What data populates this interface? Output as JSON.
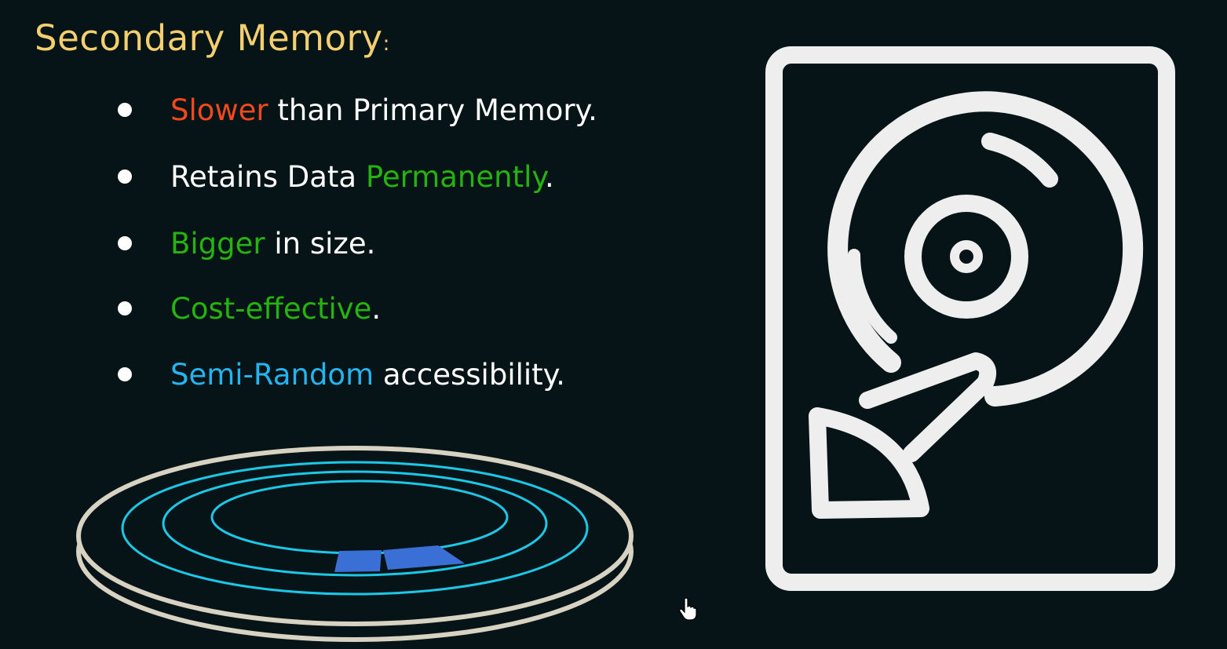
{
  "slide": {
    "title": "Secondary Memory",
    "title_colon": ":",
    "bullets": [
      {
        "pre": "",
        "highlight": "Slower",
        "post": " than Primary Memory."
      },
      {
        "pre": "Retains Data ",
        "highlight": "Permanently",
        "post": "."
      },
      {
        "pre": "",
        "highlight": "Bigger",
        "post": " in size."
      },
      {
        "pre": "",
        "highlight": "Cost-effective",
        "post": "."
      },
      {
        "pre": "",
        "highlight": "Semi-Random",
        "post": " accessibility."
      }
    ]
  },
  "colors": {
    "background": "#071417",
    "title": "#f3cf6f",
    "red": "#f04a1c",
    "green": "#25b30f",
    "cyan": "#22b5ef",
    "track": "#1cc8e8",
    "sector": "#3a6fd6",
    "platter_edge": "#d8d2c2",
    "icon_stroke": "#eeeeee"
  },
  "icons": {
    "disk_platter": "disk-platter-illustration",
    "hard_drive": "hard-drive-icon",
    "cursor": "hand-pointer-icon"
  }
}
